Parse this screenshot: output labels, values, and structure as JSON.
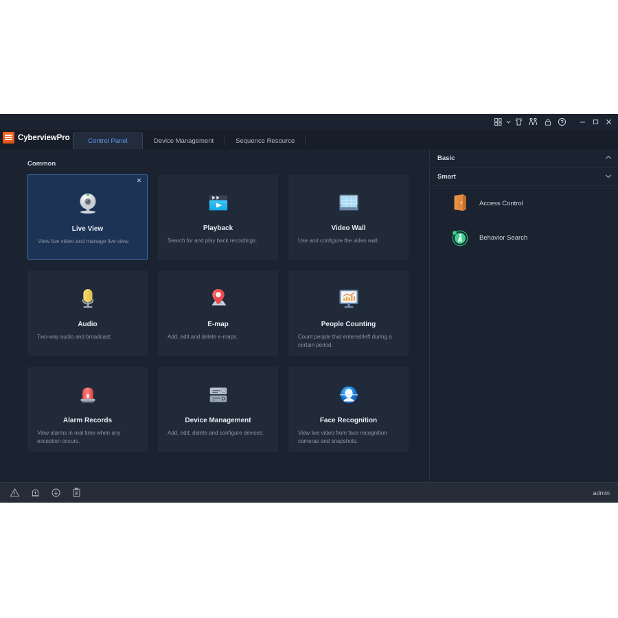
{
  "app": {
    "brand": "CyberviewPro",
    "logo_icon": "orange-square-logo"
  },
  "titlebar": {
    "icons": [
      {
        "name": "layout-grid-icon",
        "glyph": "grid"
      },
      {
        "name": "chevron-down-icon",
        "glyph": "chevron-down"
      },
      {
        "name": "alarm-shirt-icon",
        "glyph": "shirt"
      },
      {
        "name": "people-icon",
        "glyph": "people"
      },
      {
        "name": "lock-icon",
        "glyph": "lock"
      },
      {
        "name": "help-icon",
        "glyph": "help"
      }
    ],
    "window_controls": [
      {
        "name": "minimize-button",
        "glyph": "minimize"
      },
      {
        "name": "maximize-button",
        "glyph": "maximize"
      },
      {
        "name": "close-button",
        "glyph": "close"
      }
    ]
  },
  "tabs": [
    {
      "label": "Control Panel",
      "active": true
    },
    {
      "label": "Device Management",
      "active": false
    },
    {
      "label": "Sequence Resource",
      "active": false
    }
  ],
  "main": {
    "section_title": "Common",
    "cards": [
      {
        "title": "Live View",
        "desc": "View live video and manage live view.",
        "icon": "webcam-icon",
        "selected": true,
        "closable": true
      },
      {
        "title": "Playback",
        "desc": "Search for and play back recordings.",
        "icon": "clapperboard-play-icon",
        "selected": false,
        "closable": false
      },
      {
        "title": "Video Wall",
        "desc": "Use and configure the video wall.",
        "icon": "video-wall-icon",
        "selected": false,
        "closable": false
      },
      {
        "title": "Audio",
        "desc": "Two-way audio and broadcast.",
        "icon": "microphone-icon",
        "selected": false,
        "closable": false
      },
      {
        "title": "E-map",
        "desc": "Add, edit and delete e-maps.",
        "icon": "map-pin-icon",
        "selected": false,
        "closable": false
      },
      {
        "title": "People Counting",
        "desc": "Count people that entered/left during a certain period.",
        "icon": "monitor-chart-icon",
        "selected": false,
        "closable": false
      },
      {
        "title": "Alarm Records",
        "desc": "View alarms in real time when any exception occurs.",
        "icon": "siren-icon",
        "selected": false,
        "closable": false
      },
      {
        "title": "Device Management",
        "desc": "Add, edit, delete and configure devices.",
        "icon": "server-gear-icon",
        "selected": false,
        "closable": false
      },
      {
        "title": "Face Recognition",
        "desc": "View live video from face recognition cameras and snapshots.",
        "icon": "face-recognition-icon",
        "selected": false,
        "closable": false
      }
    ]
  },
  "right_panel": {
    "groups": [
      {
        "label": "Basic",
        "chevron": "⌃",
        "expanded": false
      },
      {
        "label": "Smart",
        "chevron": "⌄",
        "expanded": true
      }
    ],
    "smart_items": [
      {
        "label": "Access Control",
        "icon": "door-icon"
      },
      {
        "label": "Behavior Search",
        "icon": "walking-person-icon"
      }
    ]
  },
  "statusbar": {
    "icons": [
      {
        "name": "warning-triangle-icon"
      },
      {
        "name": "alarm-upload-icon"
      },
      {
        "name": "download-icon"
      },
      {
        "name": "clipboard-log-icon"
      }
    ],
    "user": "admin"
  },
  "colors": {
    "accent_orange": "#f26522",
    "tab_active_text": "#5b9ae8",
    "card_bg": "#212a39",
    "card_selected_bg": "#1d3356",
    "card_selected_border": "#3e6fa8",
    "window_bg": "#1b2230",
    "statusbar_bg": "#262d39"
  }
}
